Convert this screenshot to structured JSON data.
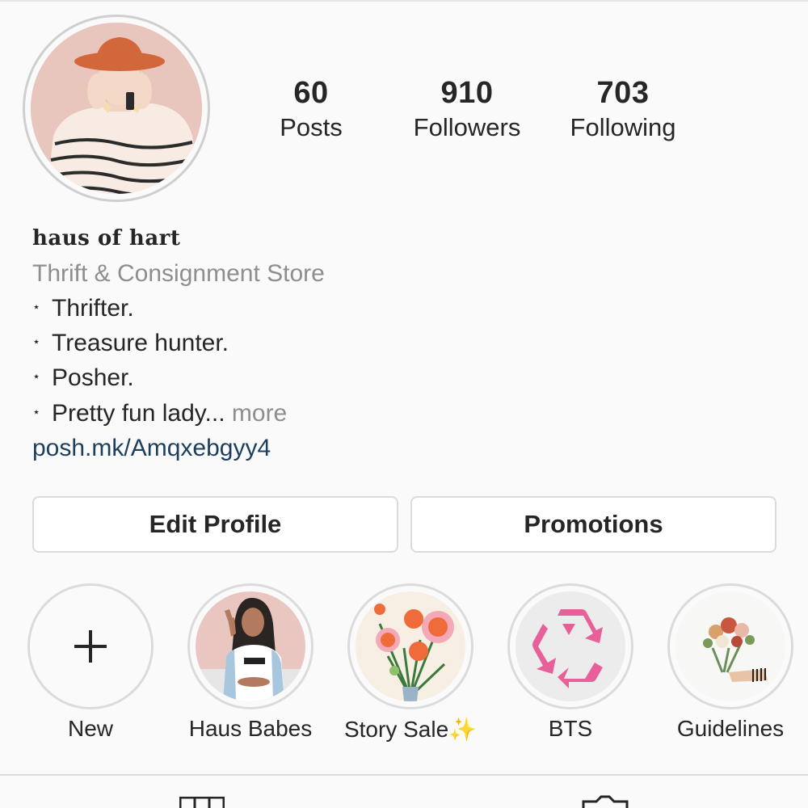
{
  "profile": {
    "name": "haus of hart",
    "category": "Thrift & Consignment Store",
    "bio_lines": [
      "Thrifter.",
      "Treasure hunter.",
      "Posher.",
      "Pretty fun lady..."
    ],
    "bio_bullet": "⋆",
    "more_label": "more",
    "link": "posh.mk/Amqxebgyy4"
  },
  "stats": {
    "posts": {
      "value": "60",
      "label": "Posts"
    },
    "followers": {
      "value": "910",
      "label": "Followers"
    },
    "following": {
      "value": "703",
      "label": "Following"
    }
  },
  "buttons": {
    "edit_profile": "Edit Profile",
    "promotions": "Promotions"
  },
  "highlights": [
    {
      "label": "New",
      "icon": "plus-icon"
    },
    {
      "label": "Haus Babes"
    },
    {
      "label": "Story Sale✨"
    },
    {
      "label": "BTS",
      "icon": "recycle-icon"
    },
    {
      "label": "Guidelines"
    }
  ],
  "colors": {
    "link": "#1c3f5e",
    "muted": "#8e8e8e",
    "recycle_pink": "#e8609a"
  }
}
